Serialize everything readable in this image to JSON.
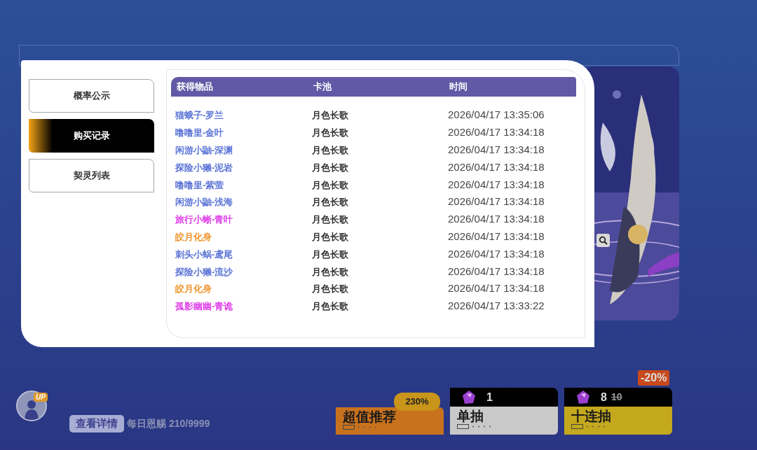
{
  "menu": [
    {
      "label": "概率公示",
      "selected": false
    },
    {
      "label": "购买记录",
      "selected": true
    },
    {
      "label": "契灵列表",
      "selected": false
    }
  ],
  "table": {
    "columns": [
      "获得物品",
      "卡池",
      "时间"
    ],
    "rows": [
      {
        "item": "猫蛾子-罗兰",
        "color": "#5b74d6",
        "pool": "月色长歌",
        "time": "2026/04/17 13:35:06"
      },
      {
        "item": "噜噜里-金叶",
        "color": "#5b74d6",
        "pool": "月色长歌",
        "time": "2026/04/17 13:34:18"
      },
      {
        "item": "闲游小鼬-深渊",
        "color": "#5b74d6",
        "pool": "月色长歌",
        "time": "2026/04/17 13:34:18"
      },
      {
        "item": "探险小獭-泥岩",
        "color": "#5b74d6",
        "pool": "月色长歌",
        "time": "2026/04/17 13:34:18"
      },
      {
        "item": "噜噜里-紫萤",
        "color": "#5b74d6",
        "pool": "月色长歌",
        "time": "2026/04/17 13:34:18"
      },
      {
        "item": "闲游小鼬-浅海",
        "color": "#5b74d6",
        "pool": "月色长歌",
        "time": "2026/04/17 13:34:18"
      },
      {
        "item": "旅行小蜥-青叶",
        "color": "#e03ee8",
        "pool": "月色长歌",
        "time": "2026/04/17 13:34:18"
      },
      {
        "item": "皎月化身",
        "color": "#f0962e",
        "pool": "月色长歌",
        "time": "2026/04/17 13:34:18"
      },
      {
        "item": "刺头小蜗-鸢尾",
        "color": "#5b74d6",
        "pool": "月色长歌",
        "time": "2026/04/17 13:34:18"
      },
      {
        "item": "探险小獭-流沙",
        "color": "#5b74d6",
        "pool": "月色长歌",
        "time": "2026/04/17 13:34:18"
      },
      {
        "item": "皎月化身",
        "color": "#f0962e",
        "pool": "月色长歌",
        "time": "2026/04/17 13:34:18"
      },
      {
        "item": "孤影幽幽-青诡",
        "color": "#e03ee8",
        "pool": "月色长歌",
        "time": "2026/04/17 13:33:22"
      }
    ]
  },
  "footer": {
    "avatar_badge": "UP",
    "details_button": "查看详情",
    "daily": "每日恩赐 210/9999"
  },
  "offers": [
    {
      "kind": "bundle",
      "label": "超值推荐",
      "badge": "230%"
    },
    {
      "kind": "single",
      "label": "单抽",
      "price": "1"
    },
    {
      "kind": "ten",
      "label": "十连抽",
      "price": "8",
      "old_price": "10",
      "discount": "-20%"
    }
  ]
}
